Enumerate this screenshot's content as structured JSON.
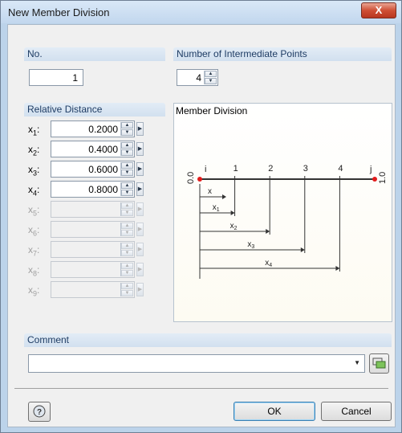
{
  "window": {
    "title": "New Member Division",
    "close_symbol": "X"
  },
  "no_group": {
    "label": "No.",
    "value": "1"
  },
  "intermediate_group": {
    "label": "Number of Intermediate Points",
    "value": "4"
  },
  "relative_group": {
    "label": "Relative Distance",
    "rows": [
      {
        "var": "x",
        "sub": "1",
        "value": "0.2000",
        "enabled": true
      },
      {
        "var": "x",
        "sub": "2",
        "value": "0.4000",
        "enabled": true
      },
      {
        "var": "x",
        "sub": "3",
        "value": "0.6000",
        "enabled": true
      },
      {
        "var": "x",
        "sub": "4",
        "value": "0.8000",
        "enabled": true
      },
      {
        "var": "x",
        "sub": "5",
        "value": "",
        "enabled": false
      },
      {
        "var": "x",
        "sub": "6",
        "value": "",
        "enabled": false
      },
      {
        "var": "x",
        "sub": "7",
        "value": "",
        "enabled": false
      },
      {
        "var": "x",
        "sub": "8",
        "value": "",
        "enabled": false
      },
      {
        "var": "x",
        "sub": "9",
        "value": "",
        "enabled": false
      }
    ]
  },
  "preview": {
    "title": "Member Division",
    "end_i_label": "0.0",
    "end_j_label": "1.0",
    "node_i": "i",
    "node_j": "j",
    "point_labels": [
      "1",
      "2",
      "3",
      "4"
    ],
    "dim_x": "x",
    "dim_labels": [
      "x",
      "x",
      "x",
      "x"
    ],
    "dim_subs": [
      "1",
      "2",
      "3",
      "4"
    ],
    "colors": {
      "member": "#333333",
      "node": "#e21c1c",
      "dim": "#222222"
    }
  },
  "comment_group": {
    "label": "Comment",
    "value": ""
  },
  "footer": {
    "ok_label": "OK",
    "cancel_label": "Cancel"
  },
  "icons": {
    "help": "help-icon",
    "comment_picker": "comment-library-icon",
    "close": "close-icon"
  }
}
